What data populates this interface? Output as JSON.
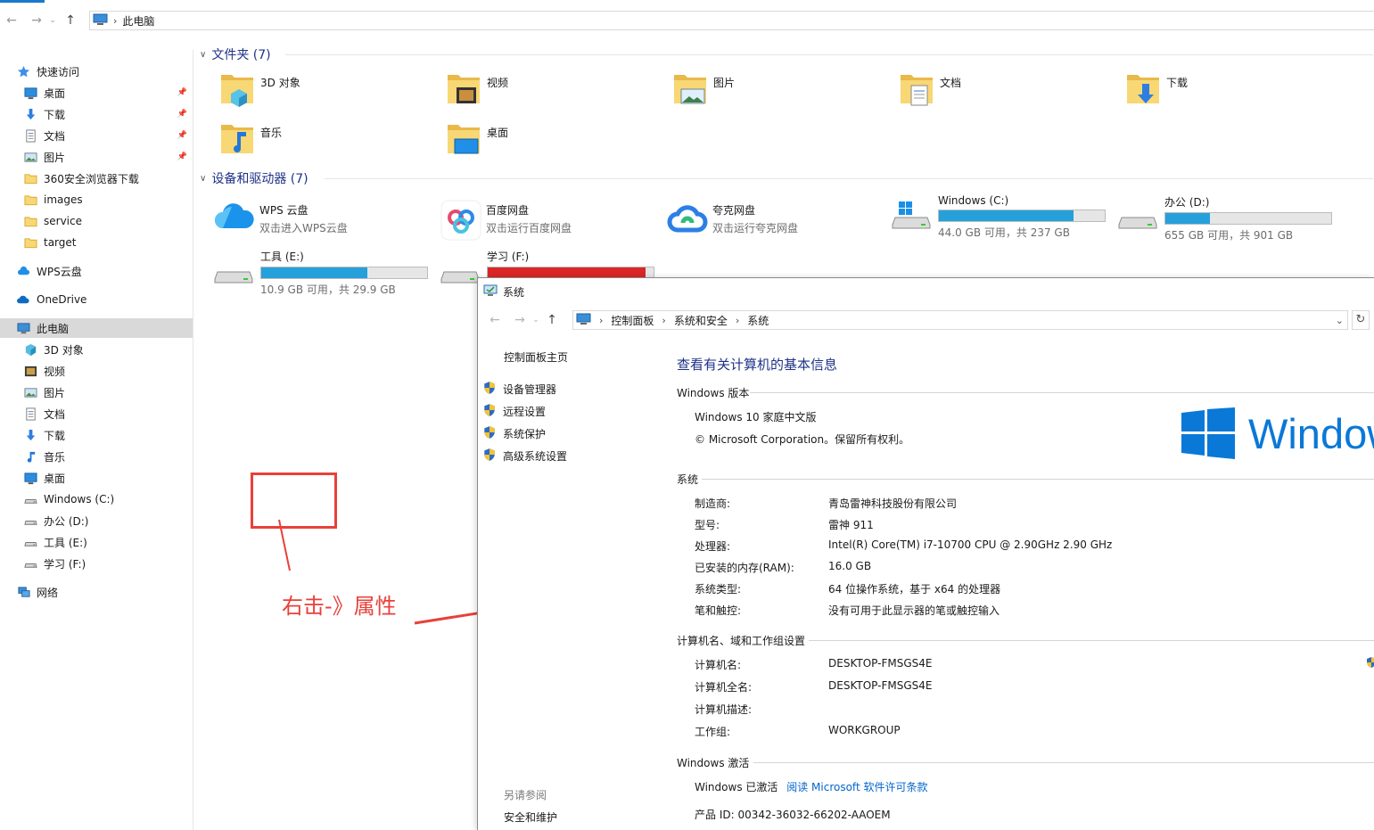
{
  "explorer": {
    "address": "此电脑",
    "sidebar": [
      {
        "label": "快速访问",
        "icon": "star-icon",
        "top": 0
      },
      {
        "label": "桌面",
        "icon": "desktop-icon",
        "pin": true
      },
      {
        "label": "下载",
        "icon": "download-icon",
        "pin": true
      },
      {
        "label": "文档",
        "icon": "document-icon",
        "pin": true
      },
      {
        "label": "图片",
        "icon": "picture-icon",
        "pin": true
      },
      {
        "label": "360安全浏览器下载",
        "icon": "folder-icon"
      },
      {
        "label": "images",
        "icon": "folder-icon"
      },
      {
        "label": "service",
        "icon": "folder-icon"
      },
      {
        "label": "target",
        "icon": "folder-icon"
      },
      {
        "label": "WPS云盘",
        "icon": "wps-cloud-icon"
      },
      {
        "label": "OneDrive",
        "icon": "onedrive-icon"
      },
      {
        "label": "此电脑",
        "icon": "pc-icon",
        "selected": true
      },
      {
        "label": "3D 对象",
        "icon": "3d-objects-icon"
      },
      {
        "label": "视频",
        "icon": "video-icon"
      },
      {
        "label": "图片",
        "icon": "picture-icon"
      },
      {
        "label": "文档",
        "icon": "document-icon"
      },
      {
        "label": "下载",
        "icon": "download-icon"
      },
      {
        "label": "音乐",
        "icon": "music-icon"
      },
      {
        "label": "桌面",
        "icon": "desktop-icon"
      },
      {
        "label": "Windows (C:)",
        "icon": "drive-icon"
      },
      {
        "label": "办公 (D:)",
        "icon": "drive-icon"
      },
      {
        "label": "工具 (E:)",
        "icon": "drive-icon"
      },
      {
        "label": "学习 (F:)",
        "icon": "drive-icon"
      },
      {
        "label": "网络",
        "icon": "network-icon"
      }
    ],
    "folders_header": "文件夹 (7)",
    "folders": [
      "3D 对象",
      "视频",
      "图片",
      "文档",
      "下载",
      "音乐",
      "桌面"
    ],
    "devices_header": "设备和驱动器 (7)",
    "clouds": [
      {
        "name": "WPS 云盘",
        "sub": "双击进入WPS云盘"
      },
      {
        "name": "百度网盘",
        "sub": "双击运行百度网盘"
      },
      {
        "name": "夸克网盘",
        "sub": "双击运行夸克网盘"
      }
    ],
    "drives": [
      {
        "name": "Windows (C:)",
        "cap": "44.0 GB 可用，共 237 GB",
        "used": 0.81,
        "color": "#26a0da"
      },
      {
        "name": "办公 (D:)",
        "cap": "655 GB 可用，共 901 GB",
        "used": 0.27,
        "color": "#26a0da"
      },
      {
        "name": "工具 (E:)",
        "cap": "10.9 GB 可用，共 29.9 GB",
        "used": 0.64,
        "color": "#26a0da"
      },
      {
        "name": "学习 (F:)",
        "cap": "",
        "used": 0.95,
        "color": "#da2626"
      }
    ]
  },
  "annotation": "右击-》属性",
  "system": {
    "title": "系统",
    "breadcrumb": [
      "控制面板",
      "系统和安全",
      "系统"
    ],
    "left_home": "控制面板主页",
    "left_links": [
      "设备管理器",
      "远程设置",
      "系统保护",
      "高级系统设置"
    ],
    "see_also": "另请参阅",
    "see_also_links": [
      "安全和维护"
    ],
    "main_title": "查看有关计算机的基本信息",
    "edition_header": "Windows 版本",
    "edition": "Windows 10 家庭中文版",
    "copyright": "© Microsoft Corporation。保留所有权利。",
    "logo_text": "Windows",
    "system_header": "系统",
    "system_rows": [
      {
        "k": "制造商:",
        "v": "青岛雷神科技股份有限公司"
      },
      {
        "k": "型号:",
        "v": "雷神 911"
      },
      {
        "k": "处理器:",
        "v": "Intel(R) Core(TM) i7-10700 CPU @ 2.90GHz   2.90 GHz"
      },
      {
        "k": "已安装的内存(RAM):",
        "v": "16.0 GB"
      },
      {
        "k": "系统类型:",
        "v": "64 位操作系统，基于 x64 的处理器"
      },
      {
        "k": "笔和触控:",
        "v": "没有可用于此显示器的笔或触控输入"
      }
    ],
    "computer_header": "计算机名、域和工作组设置",
    "computer_rows": [
      {
        "k": "计算机名:",
        "v": "DESKTOP-FMSGS4E"
      },
      {
        "k": "计算机全名:",
        "v": "DESKTOP-FMSGS4E"
      },
      {
        "k": "计算机描述:",
        "v": ""
      },
      {
        "k": "工作组:",
        "v": "WORKGROUP"
      }
    ],
    "activation_header": "Windows 激活",
    "activated": "Windows 已激活",
    "license_link": "阅读 Microsoft 软件许可条款",
    "product_id": "产品 ID: 00342-36032-66202-AAOEM"
  },
  "colors": {
    "accent": "#1979ca",
    "link": "#0066cc",
    "header_blue": "#1e3287",
    "annotation_red": "#e8403a"
  }
}
